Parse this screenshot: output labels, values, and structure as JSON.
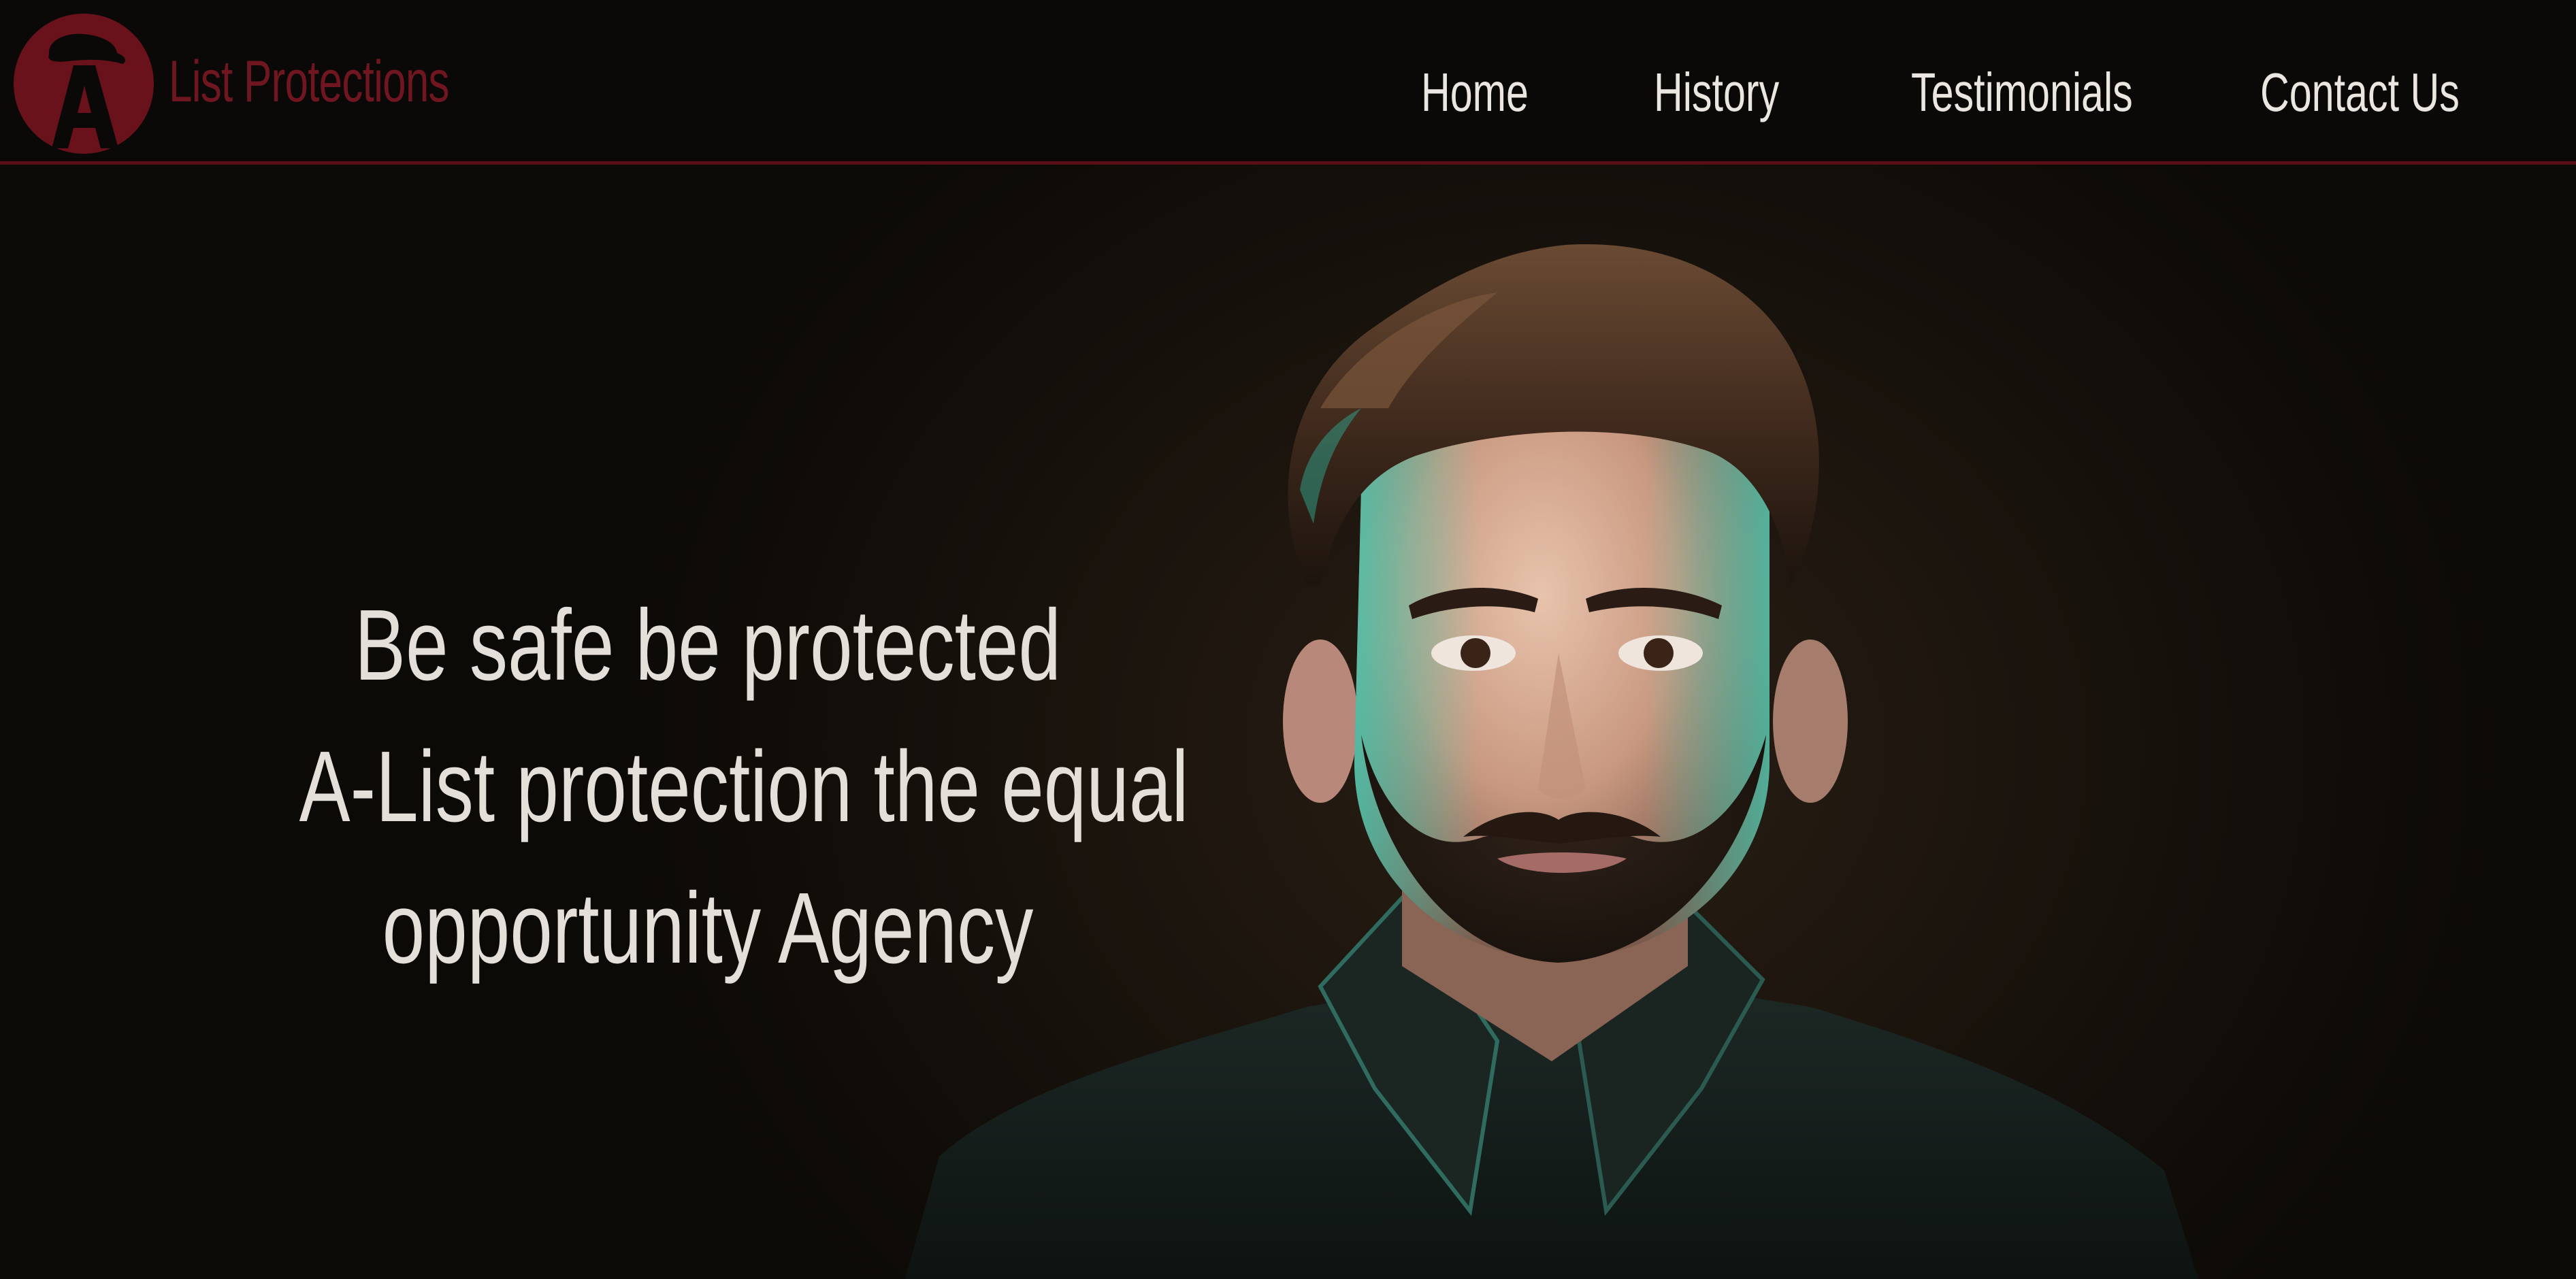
{
  "header": {
    "brand_name": "List Protections",
    "logo_icon": "a-list-hat-logo-icon",
    "colors": {
      "brand": "#6f1620",
      "logo_circle": "#6a121b",
      "divider": "#5a0e16",
      "nav_text": "#ebe6df"
    }
  },
  "nav": {
    "items": [
      {
        "label": "Home"
      },
      {
        "label": "History"
      },
      {
        "label": "Testimonials"
      },
      {
        "label": "Contact Us"
      }
    ]
  },
  "hero": {
    "lines": [
      "Be safe be protected",
      "A-List protection the equal",
      "opportunity Agency"
    ],
    "image": "portrait-photo",
    "text_color": "#e4dfd8"
  }
}
